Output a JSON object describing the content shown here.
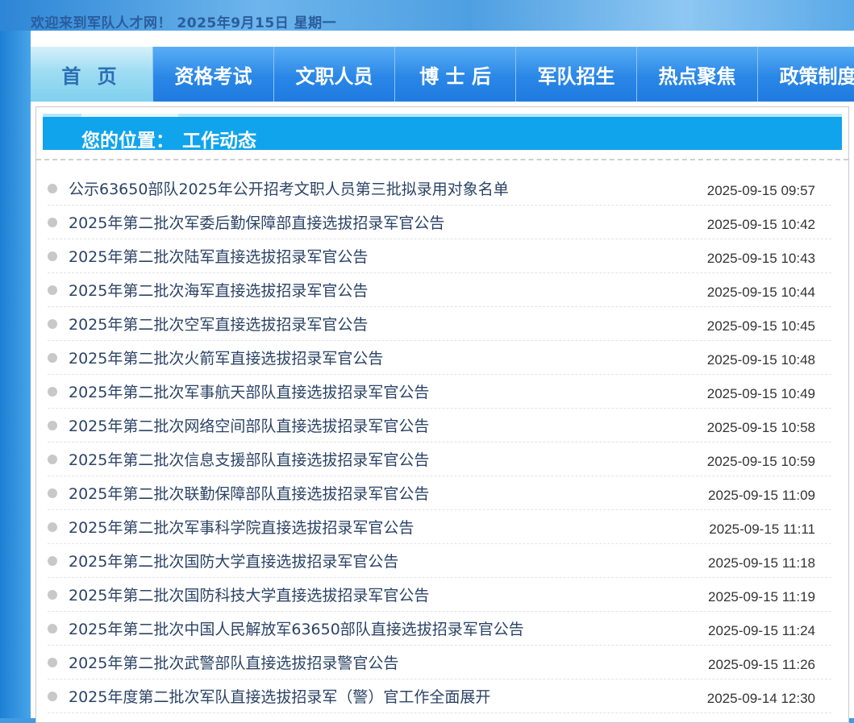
{
  "header": {
    "welcome": "欢迎来到军队人才网！ 2025年9月15日 星期一"
  },
  "nav": {
    "items": [
      {
        "label": "首 页",
        "active": true
      },
      {
        "label": "资格考试"
      },
      {
        "label": "文职人员"
      },
      {
        "label": "博 士 后"
      },
      {
        "label": "军队招生"
      },
      {
        "label": "热点聚焦"
      },
      {
        "label": "政策制度"
      }
    ]
  },
  "location": {
    "label": "您的位置：",
    "value": "工作动态"
  },
  "news": [
    {
      "title": "公示63650部队2025年公开招考文职人员第三批拟录用对象名单",
      "date": "2025-09-15 09:57"
    },
    {
      "title": "2025年第二批次军委后勤保障部直接选拔招录军官公告",
      "date": "2025-09-15 10:42"
    },
    {
      "title": "2025年第二批次陆军直接选拔招录军官公告",
      "date": "2025-09-15 10:43"
    },
    {
      "title": "2025年第二批次海军直接选拔招录军官公告",
      "date": "2025-09-15 10:44"
    },
    {
      "title": "2025年第二批次空军直接选拔招录军官公告",
      "date": "2025-09-15 10:45"
    },
    {
      "title": "2025年第二批次火箭军直接选拔招录军官公告",
      "date": "2025-09-15 10:48"
    },
    {
      "title": "2025年第二批次军事航天部队直接选拔招录军官公告",
      "date": "2025-09-15 10:49"
    },
    {
      "title": "2025年第二批次网络空间部队直接选拔招录军官公告",
      "date": "2025-09-15 10:58"
    },
    {
      "title": "2025年第二批次信息支援部队直接选拔招录军官公告",
      "date": "2025-09-15 10:59"
    },
    {
      "title": "2025年第二批次联勤保障部队直接选拔招录军官公告",
      "date": "2025-09-15 11:09"
    },
    {
      "title": "2025年第二批次军事科学院直接选拔招录军官公告",
      "date": "2025-09-15 11:11"
    },
    {
      "title": "2025年第二批次国防大学直接选拔招录军官公告",
      "date": "2025-09-15 11:18"
    },
    {
      "title": "2025年第二批次国防科技大学直接选拔招录军官公告",
      "date": "2025-09-15 11:19"
    },
    {
      "title": "2025年第二批次中国人民解放军63650部队直接选拔招录军官公告",
      "date": "2025-09-15 11:24"
    },
    {
      "title": "2025年第二批次武警部队直接选拔招录警官公告",
      "date": "2025-09-15 11:26"
    },
    {
      "title": "2025年度第二批次军队直接选拔招录军（警）官工作全面展开",
      "date": "2025-09-14 12:30"
    }
  ]
}
